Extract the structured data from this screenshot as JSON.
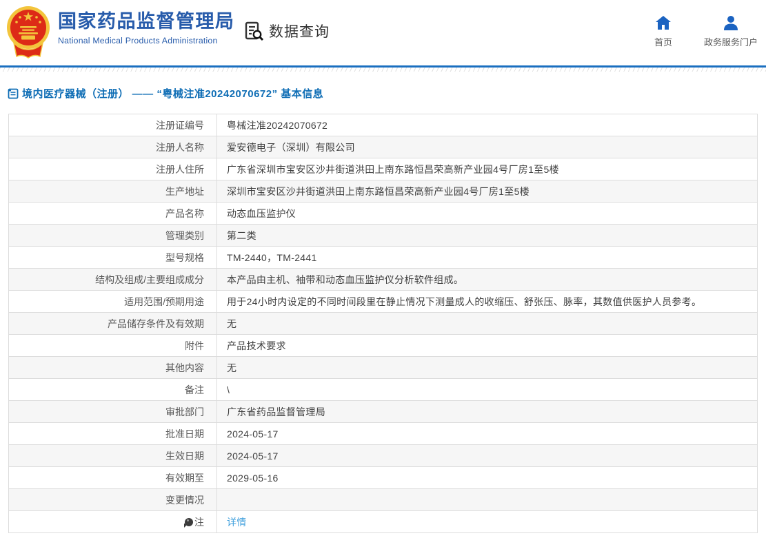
{
  "header": {
    "site_title_zh": "国家药品监督管理局",
    "site_title_en": "National Medical Products Administration",
    "section_title": "数据查询",
    "nav": {
      "home_label": "首页",
      "portal_label": "政务服务门户"
    }
  },
  "breadcrumb": {
    "text": "境内医疗器械（注册） —— “粤械注准20242070672” 基本信息"
  },
  "table": {
    "rows": [
      {
        "label": "注册证编号",
        "value": "粤械注准20242070672"
      },
      {
        "label": "注册人名称",
        "value": "爱安德电子（深圳）有限公司"
      },
      {
        "label": "注册人住所",
        "value": "广东省深圳市宝安区沙井街道洪田上南东路恒昌荣高新产业园4号厂房1至5楼"
      },
      {
        "label": "生产地址",
        "value": "深圳市宝安区沙井街道洪田上南东路恒昌荣高新产业园4号厂房1至5楼"
      },
      {
        "label": "产品名称",
        "value": "动态血压监护仪"
      },
      {
        "label": "管理类别",
        "value": "第二类"
      },
      {
        "label": "型号规格",
        "value": "TM-2440，TM-2441"
      },
      {
        "label": "结构及组成/主要组成成分",
        "value": "本产品由主机、袖带和动态血压监护仪分析软件组成。"
      },
      {
        "label": "适用范围/预期用途",
        "value": "用于24小时内设定的不同时间段里在静止情况下测量成人的收缩压、舒张压、脉率，其数值供医护人员参考。"
      },
      {
        "label": "产品储存条件及有效期",
        "value": "无"
      },
      {
        "label": "附件",
        "value": "产品技术要求"
      },
      {
        "label": "其他内容",
        "value": "无"
      },
      {
        "label": "备注",
        "value": "\\"
      },
      {
        "label": "审批部门",
        "value": "广东省药品监督管理局"
      },
      {
        "label": "批准日期",
        "value": "2024-05-17"
      },
      {
        "label": "生效日期",
        "value": "2024-05-17"
      },
      {
        "label": "有效期至",
        "value": "2029-05-16"
      },
      {
        "label": "变更情况",
        "value": ""
      },
      {
        "label": "注",
        "label_icon": "balloon-icon",
        "value": "详情",
        "value_type": "link"
      }
    ]
  },
  "colors": {
    "brand_blue": "#285cab",
    "divider_blue": "#1a6fc0",
    "breadcrumb_blue": "#0e6db5",
    "link_blue": "#41a0dd",
    "row_alt_gray": "#f6f6f6",
    "border_gray": "#dcdcdc",
    "emblem_red": "#dd2b17",
    "emblem_gold": "#f3c53c"
  }
}
